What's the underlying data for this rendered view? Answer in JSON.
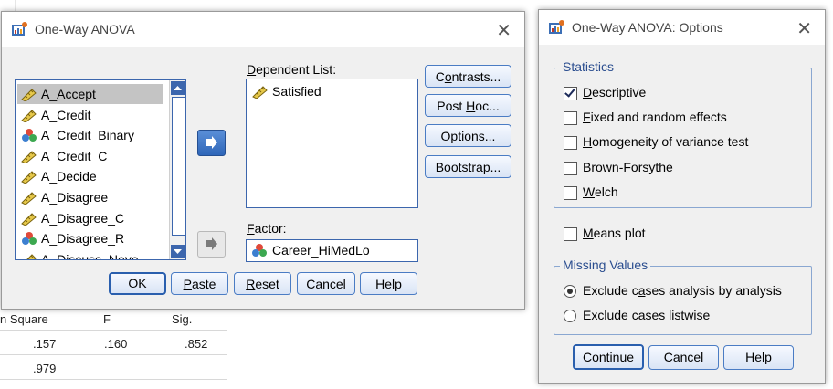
{
  "background_table": {
    "headers": [
      "n Square",
      "F",
      "Sig."
    ],
    "rows": [
      [
        ".157",
        ".160",
        ".852"
      ],
      [
        ".979",
        "",
        ""
      ]
    ]
  },
  "anova_dialog": {
    "title": "One-Way ANOVA",
    "variables": [
      {
        "name": "A_Accept",
        "type": "scale",
        "selected": true
      },
      {
        "name": "A_Credit",
        "type": "scale"
      },
      {
        "name": "A_Credit_Binary",
        "type": "nominal"
      },
      {
        "name": "A_Credit_C",
        "type": "scale"
      },
      {
        "name": "A_Decide",
        "type": "scale"
      },
      {
        "name": "A_Disagree",
        "type": "scale"
      },
      {
        "name": "A_Disagree_C",
        "type": "scale"
      },
      {
        "name": "A_Disagree_R",
        "type": "nominal"
      },
      {
        "name": "A_Discuss_Neve",
        "type": "scale"
      }
    ],
    "dependent_label": "Dependent List:",
    "dependent_items": [
      {
        "name": "Satisfied",
        "type": "scale"
      }
    ],
    "factor_label": "Factor:",
    "factor_value": "Career_HiMedLo",
    "side_buttons": [
      "Contrasts...",
      "Post Hoc...",
      "Options...",
      "Bootstrap..."
    ],
    "bottom_buttons": [
      "OK",
      "Paste",
      "Reset",
      "Cancel",
      "Help"
    ]
  },
  "options_dialog": {
    "title": "One-Way ANOVA: Options",
    "statistics_title": "Statistics",
    "statistics": [
      {
        "label": "Descriptive",
        "checked": true
      },
      {
        "label": "Fixed and random effects",
        "checked": false
      },
      {
        "label": "Homogeneity of variance test",
        "checked": false
      },
      {
        "label": "Brown-Forsythe",
        "checked": false
      },
      {
        "label": "Welch",
        "checked": false
      }
    ],
    "means_plot": {
      "label": "Means plot",
      "checked": false
    },
    "missing_title": "Missing Values",
    "missing": [
      {
        "label": "Exclude cases analysis by analysis",
        "selected": true
      },
      {
        "label": "Exclude cases listwise",
        "selected": false
      }
    ],
    "buttons": [
      "Continue",
      "Cancel",
      "Help"
    ]
  }
}
